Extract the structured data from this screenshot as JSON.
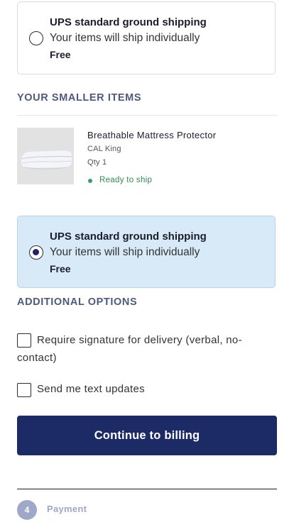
{
  "shipping_options_top": {
    "title": "UPS standard ground shipping",
    "description": "Your items will ship individually",
    "price": "Free",
    "selected": false
  },
  "smaller_items": {
    "heading": "YOUR SMALLER ITEMS",
    "product": {
      "name": "Breathable Mattress Protector",
      "size": "CAL King",
      "quantity": "Qty 1",
      "status": "Ready to ship",
      "status_color": "#3a9d63"
    },
    "shipping_option": {
      "title": "UPS standard ground shipping",
      "description": "Your items will ship individually",
      "price": "Free",
      "selected": true
    }
  },
  "additional_options": {
    "heading": "ADDITIONAL OPTIONS",
    "items": [
      {
        "label": "Require signature for delivery (verbal, no-contact)",
        "checked": false
      },
      {
        "label": "Send me text updates",
        "checked": false
      }
    ]
  },
  "continue_button": {
    "label": "Continue to billing",
    "color": "#1c2a66"
  },
  "next_step": {
    "number": "4",
    "label": "Payment"
  }
}
